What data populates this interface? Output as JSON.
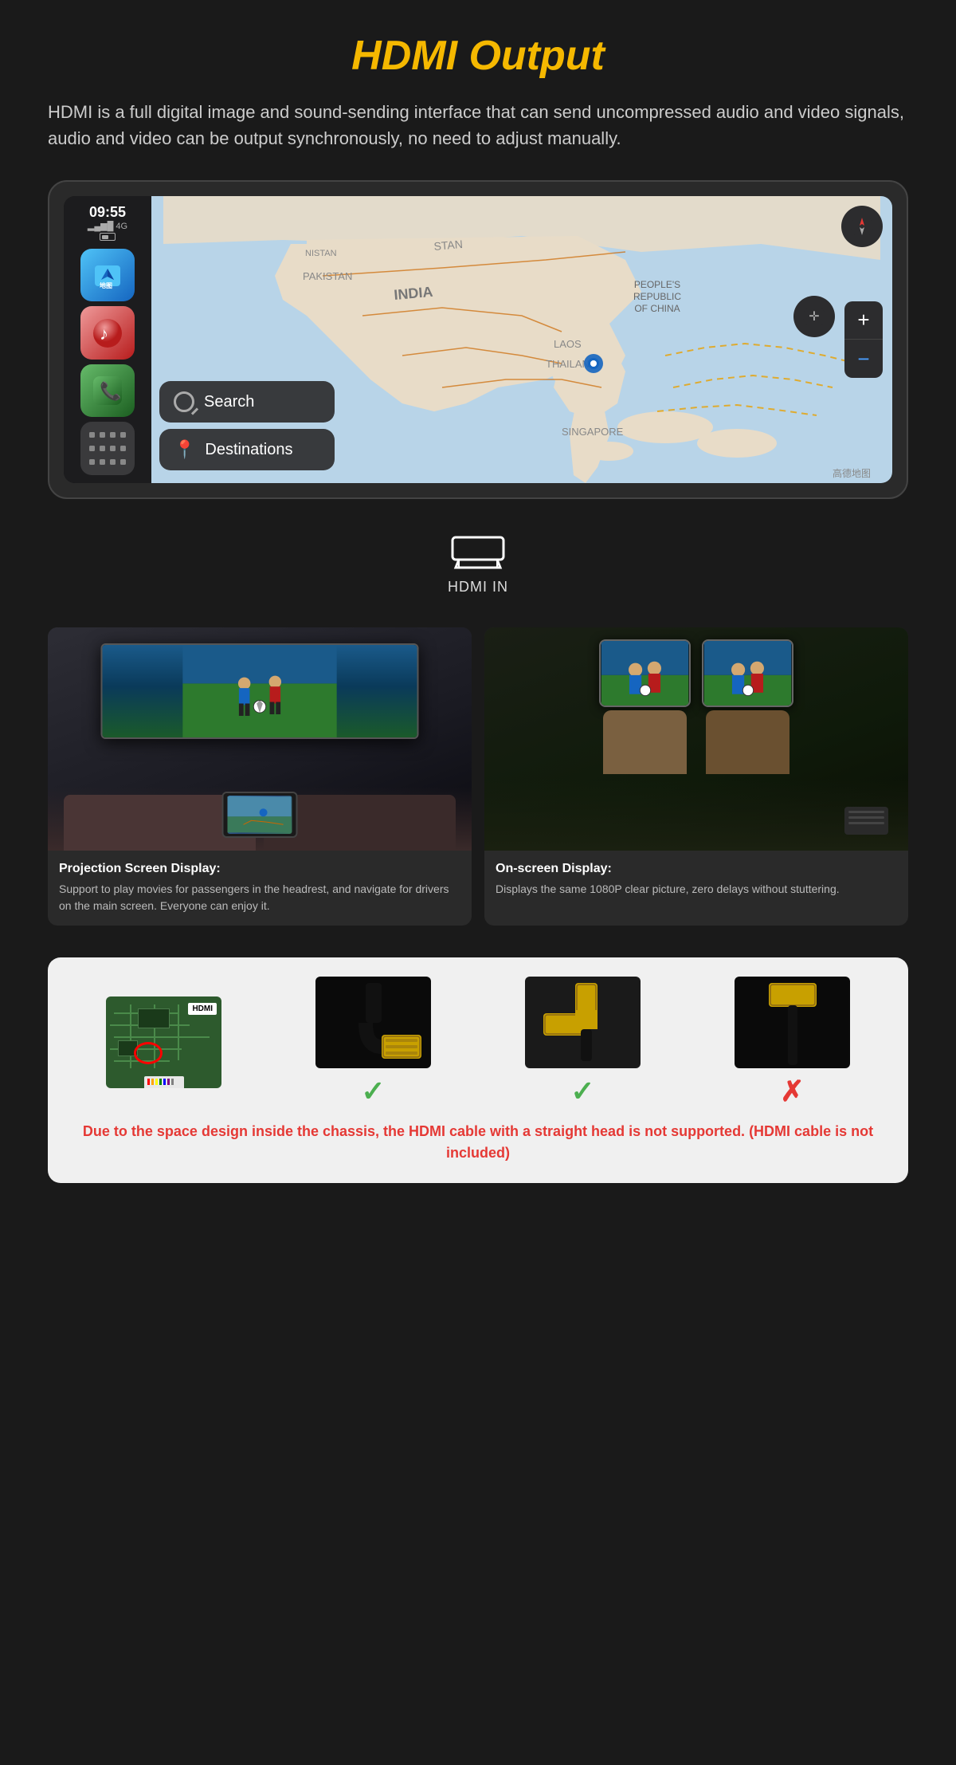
{
  "page": {
    "title": "HDMI Output",
    "background_color": "#1a1a1a"
  },
  "header": {
    "title": "HDMI Output",
    "description": "HDMI is a full digital image and sound-sending interface that can send uncompressed audio and video signals, audio and video can be output synchronously, no need to adjust manually."
  },
  "carplay": {
    "status_time": "09:55",
    "status_signal": "4G",
    "apps": [
      "Maps",
      "Music",
      "Phone"
    ],
    "map_buttons": [
      {
        "label": "Search",
        "icon": "search-icon"
      },
      {
        "label": "Destinations",
        "icon": "destination-icon"
      }
    ],
    "map_location": "INDIA / THAILAND / SINGAPORE area",
    "map_watermark": "高德地图"
  },
  "hdmi_in": {
    "label": "HDMI IN"
  },
  "photos": [
    {
      "id": "projection",
      "title": "Projection Screen Display:",
      "description": "Support to play movies for passengers in the headrest, and navigate for drivers on the main screen. Everyone can enjoy it."
    },
    {
      "id": "onscreen",
      "title": "On-screen Display:",
      "description": "Displays the same 1080P clear picture, zero delays without stuttering."
    }
  ],
  "adapters": [
    {
      "id": "pcb",
      "check": null,
      "label": "PCB board with HDMI port"
    },
    {
      "id": "angled-down",
      "check": true,
      "label": "Angled down HDMI adapter"
    },
    {
      "id": "l-shape",
      "check": true,
      "label": "L-shape HDMI adapter"
    },
    {
      "id": "straight",
      "check": false,
      "label": "Straight HDMI cable"
    }
  ],
  "warning": {
    "text": "Due to the space design inside the chassis, the HDMI cable with a straight head is not supported. (HDMI cable is not included)"
  }
}
